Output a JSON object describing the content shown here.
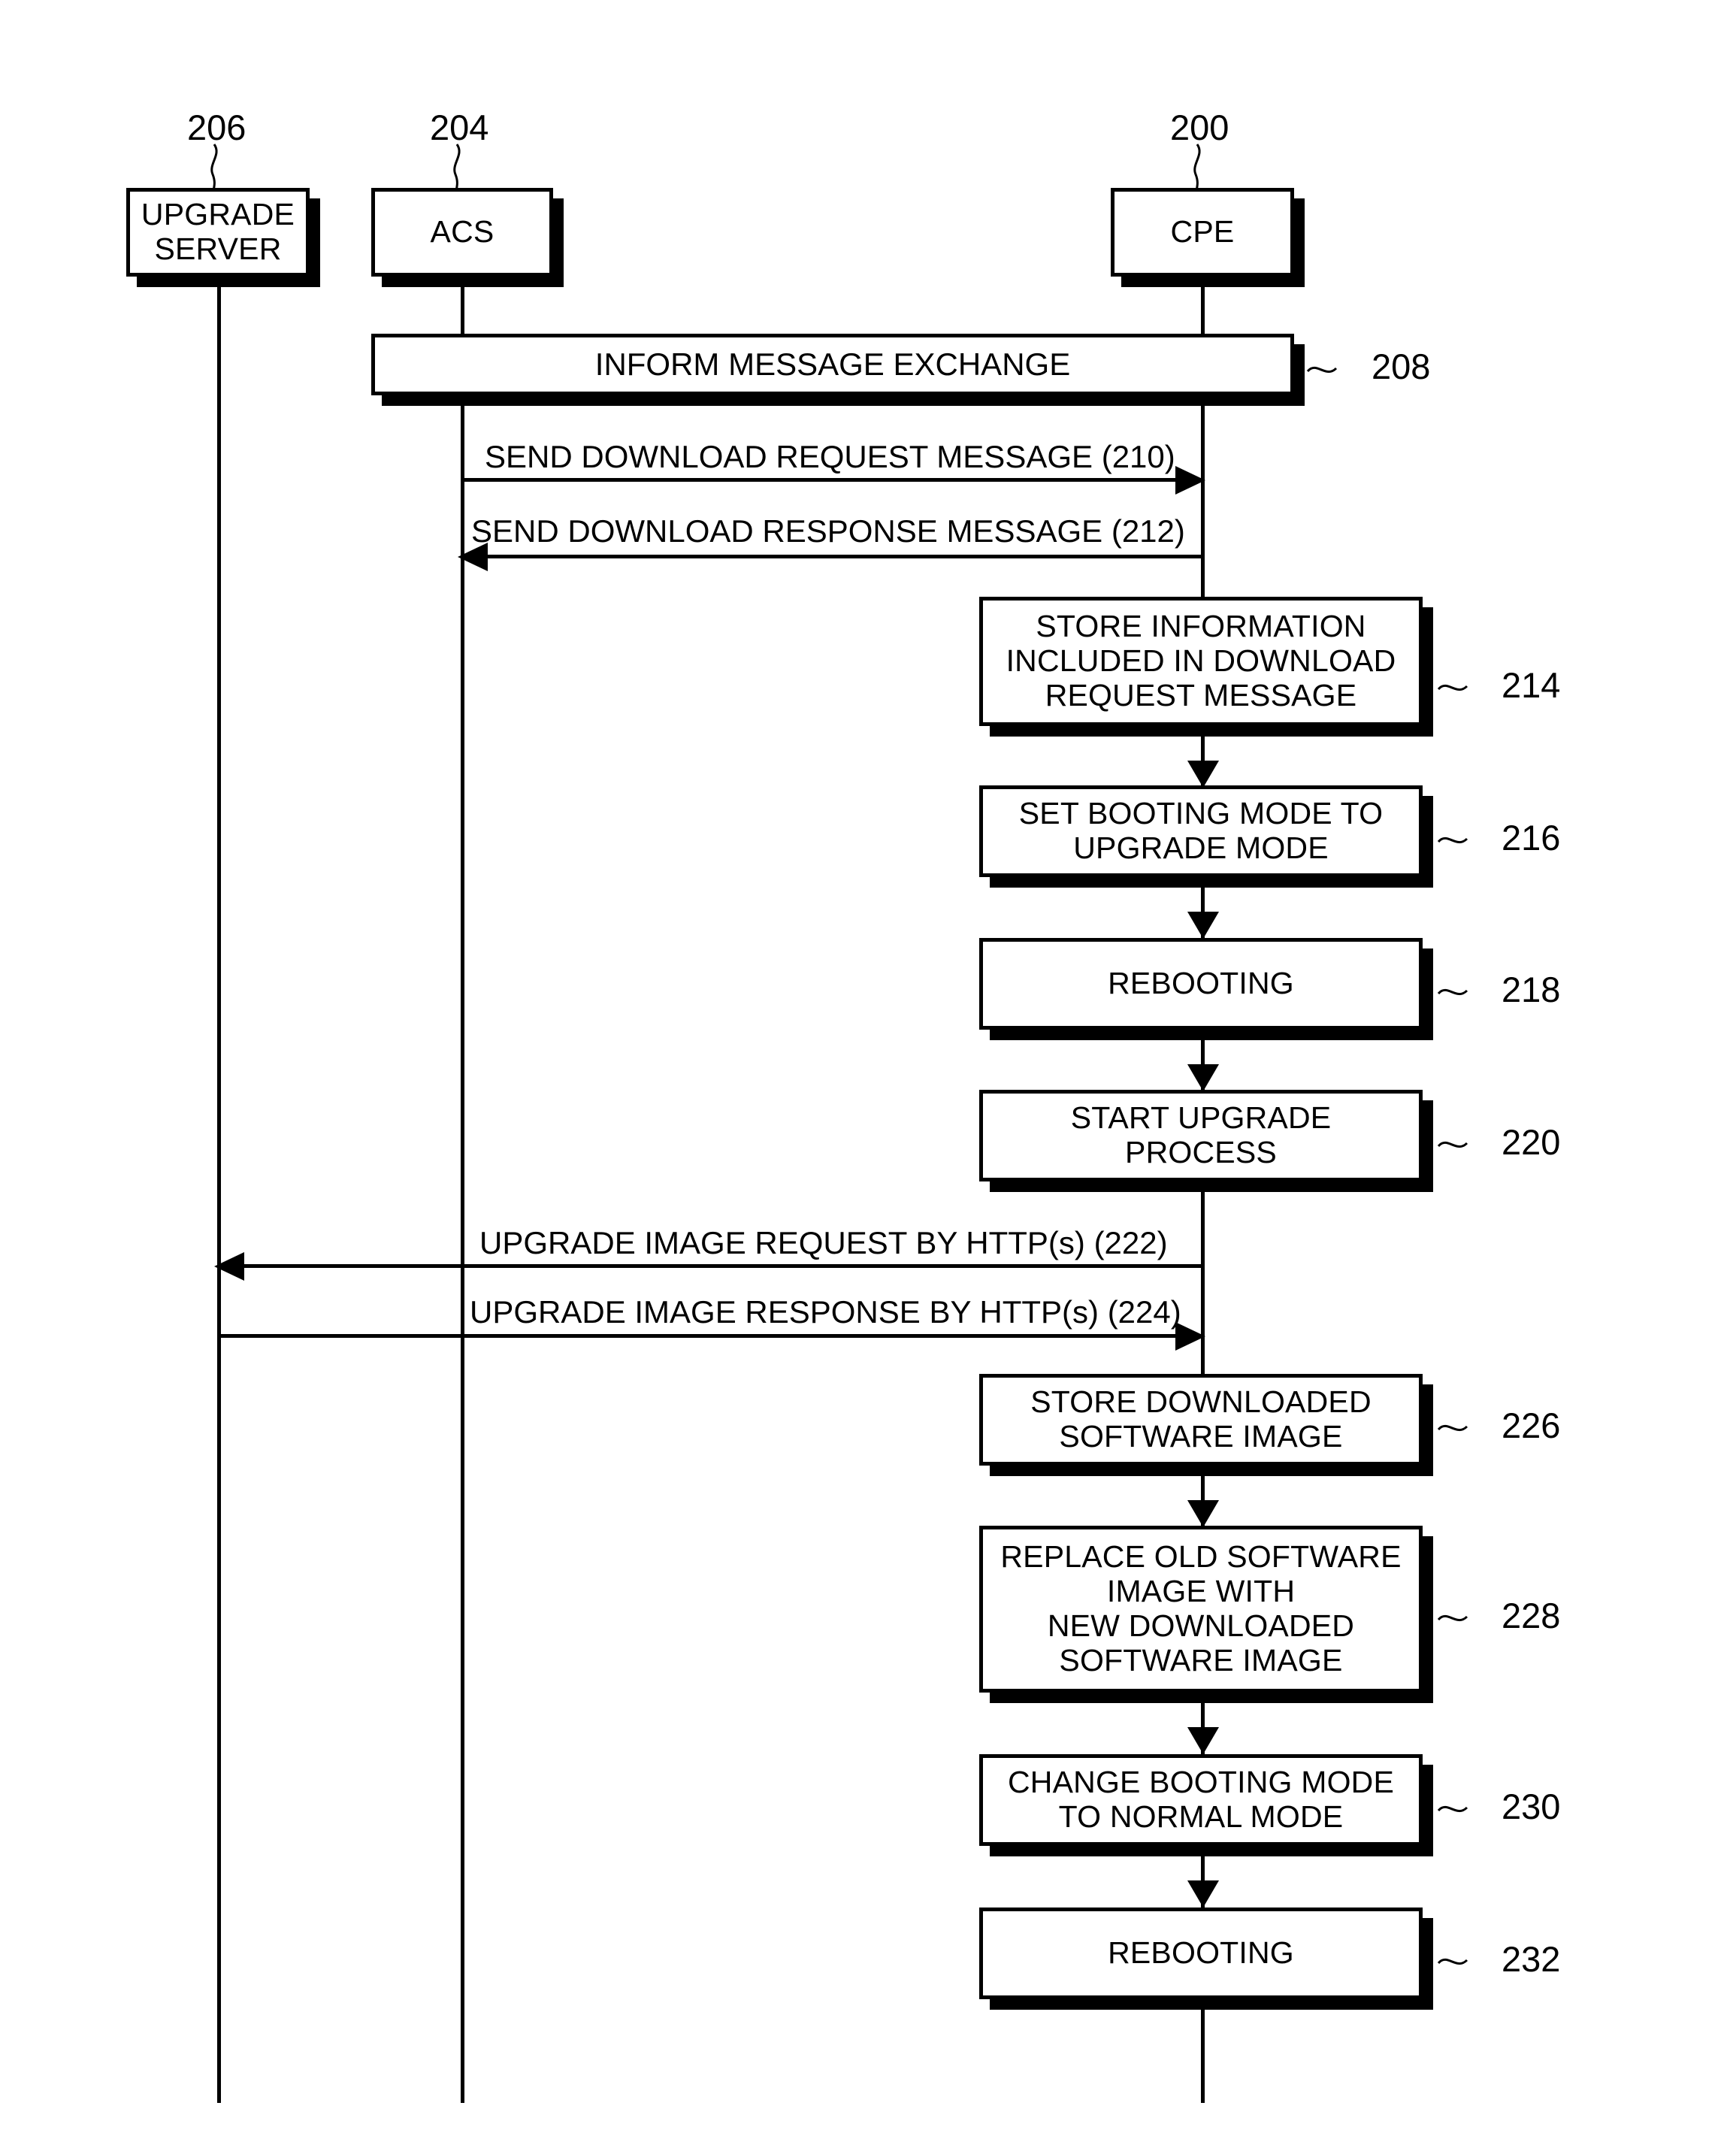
{
  "figure": {
    "type": "sequence-diagram",
    "background": "#ffffff",
    "stroke": "#000000"
  },
  "actors": [
    {
      "id": "upgrade-server",
      "label": "UPGRADE\nSERVER",
      "ref": "206",
      "line1": "UPGRADE",
      "line2": "SERVER"
    },
    {
      "id": "acs",
      "label": "ACS",
      "ref": "204"
    },
    {
      "id": "cpe",
      "label": "CPE",
      "ref": "200"
    }
  ],
  "bars": [
    {
      "id": "inform-message-exchange",
      "label": "INFORM MESSAGE EXCHANGE",
      "ref": "208"
    }
  ],
  "messages": [
    {
      "id": "send-download-request",
      "label": "SEND DOWNLOAD REQUEST MESSAGE (210)",
      "ref": "210",
      "direction": "acs-to-cpe"
    },
    {
      "id": "send-download-response",
      "label": "SEND DOWNLOAD RESPONSE MESSAGE (212)",
      "ref": "212",
      "direction": "cpe-to-acs"
    },
    {
      "id": "upgrade-image-request",
      "label": "UPGRADE IMAGE REQUEST BY HTTP(s) (222)",
      "ref": "222",
      "direction": "cpe-to-upgrade-server"
    },
    {
      "id": "upgrade-image-response",
      "label": "UPGRADE IMAGE RESPONSE BY HTTP(s) (224)",
      "ref": "224",
      "direction": "upgrade-server-to-cpe"
    }
  ],
  "steps": [
    {
      "id": "store-information",
      "ref": "214",
      "lines": [
        "STORE INFORMATION",
        "INCLUDED IN DOWNLOAD",
        "REQUEST MESSAGE"
      ]
    },
    {
      "id": "set-booting-mode-upgrade",
      "ref": "216",
      "lines": [
        "SET BOOTING MODE TO",
        "UPGRADE MODE"
      ]
    },
    {
      "id": "rebooting-first",
      "ref": "218",
      "lines": [
        "REBOOTING"
      ]
    },
    {
      "id": "start-upgrade-process",
      "ref": "220",
      "lines": [
        "START UPGRADE",
        "PROCESS"
      ]
    },
    {
      "id": "store-downloaded-software-image",
      "ref": "226",
      "lines": [
        "STORE DOWNLOADED",
        "SOFTWARE IMAGE"
      ]
    },
    {
      "id": "replace-old-software-image",
      "ref": "228",
      "lines": [
        "REPLACE OLD SOFTWARE",
        "IMAGE WITH",
        "NEW DOWNLOADED",
        "SOFTWARE IMAGE"
      ]
    },
    {
      "id": "change-booting-mode-normal",
      "ref": "230",
      "lines": [
        "CHANGE BOOTING MODE",
        "TO NORMAL MODE"
      ]
    },
    {
      "id": "rebooting-second",
      "ref": "232",
      "lines": [
        "REBOOTING"
      ]
    }
  ]
}
